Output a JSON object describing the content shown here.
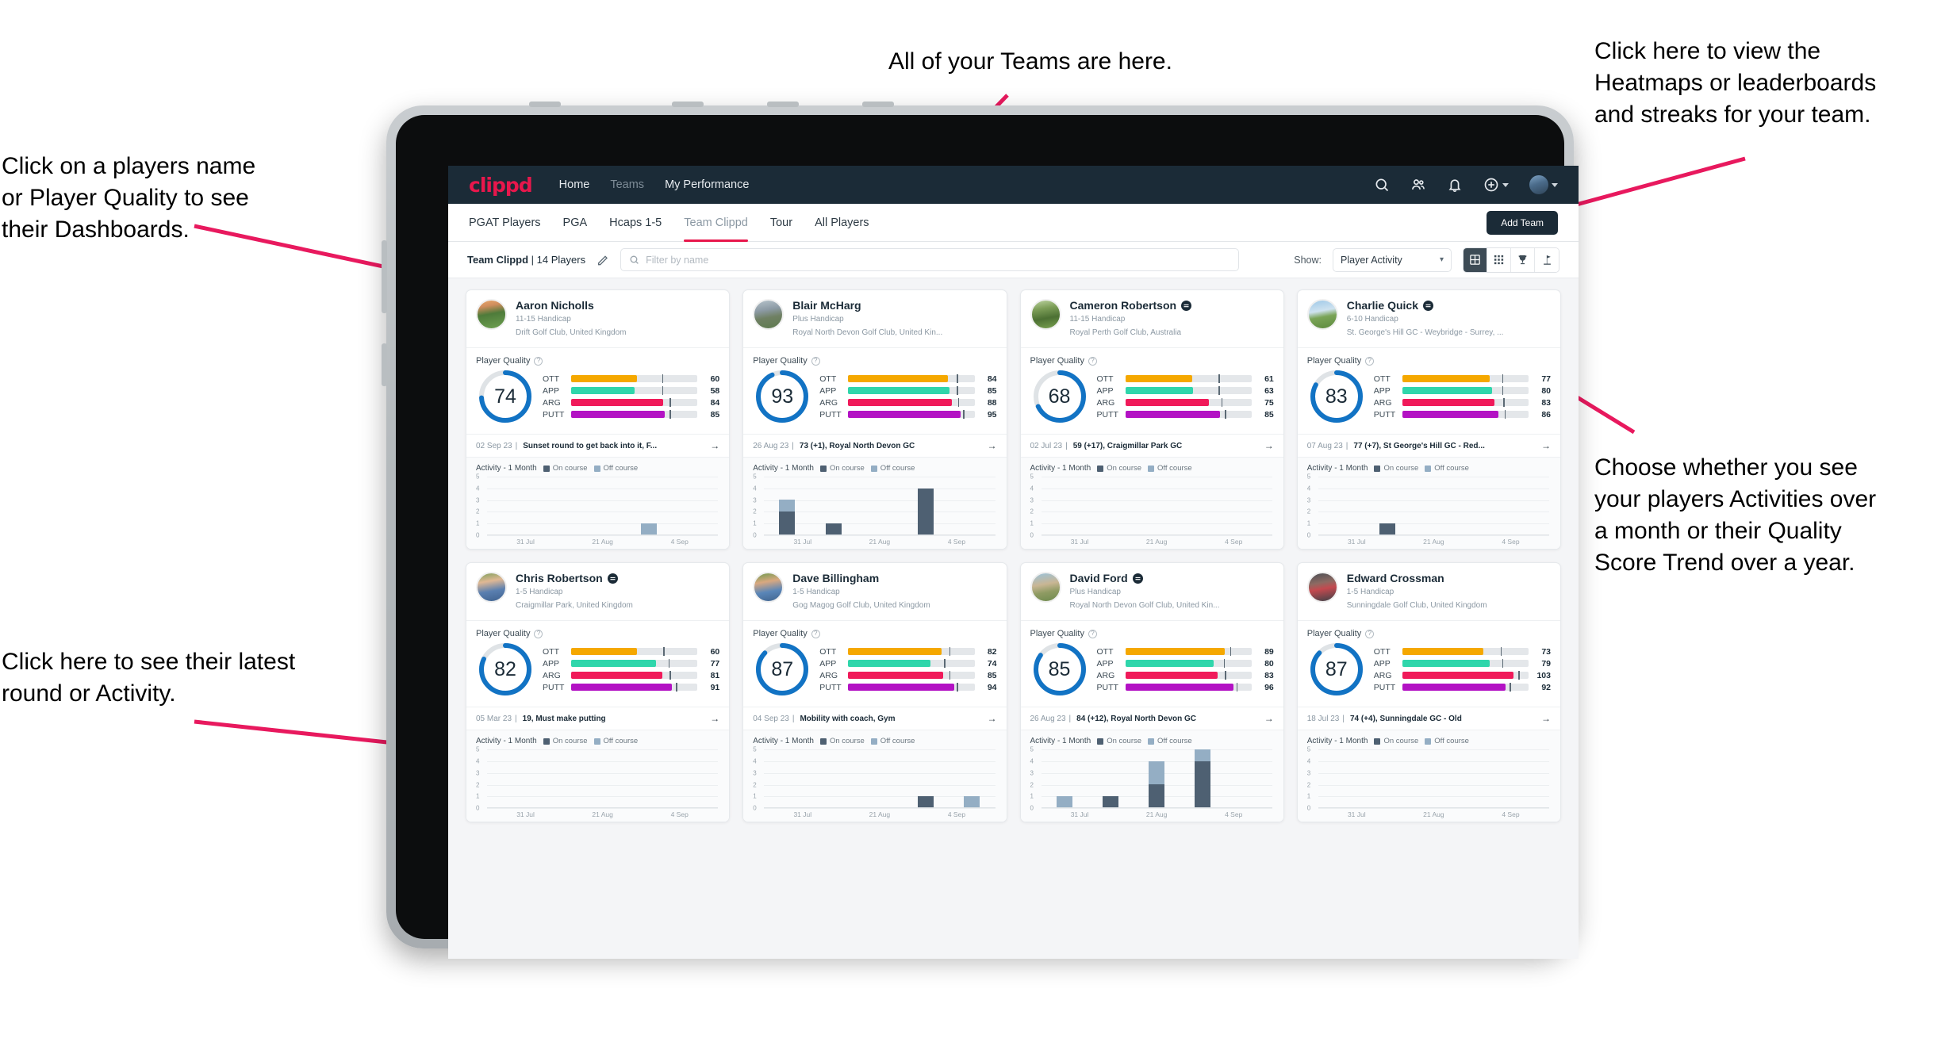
{
  "annotations": {
    "teams": "All of your Teams are here.",
    "heatmaps": "Click here to view the\nHeatmaps or leaderboards\nand streaks for your team.",
    "players": "Click on a players name\nor Player Quality to see\ntheir Dashboards.",
    "choose": "Choose whether you see\nyour players Activities over\na month or their Quality\nScore Trend over a year.",
    "round": "Click here to see their latest\nround or Activity."
  },
  "header": {
    "logo": "clippd",
    "nav": [
      {
        "label": "Home",
        "dim": false
      },
      {
        "label": "Teams",
        "dim": true
      },
      {
        "label": "My Performance",
        "dim": false
      }
    ],
    "icons": [
      "search-icon",
      "people-icon",
      "bell-icon",
      "plus-circle-icon",
      "avatar"
    ]
  },
  "tabs": [
    {
      "label": "PGAT Players",
      "active": false,
      "dim": false
    },
    {
      "label": "PGA",
      "active": false,
      "dim": false
    },
    {
      "label": "Hcaps 1-5",
      "active": false,
      "dim": false
    },
    {
      "label": "Team Clippd",
      "active": true,
      "dim": true
    },
    {
      "label": "Tour",
      "active": false,
      "dim": false
    },
    {
      "label": "All Players",
      "active": false,
      "dim": false
    }
  ],
  "add_team_label": "Add Team",
  "toolbar": {
    "team_name": "Team Clippd",
    "team_count": "14 Players",
    "search_placeholder": "Filter by name",
    "search_value": "",
    "show_label": "Show:",
    "show_value": "Player Activity",
    "views": [
      {
        "name": "grid-view",
        "active": true
      },
      {
        "name": "dense-grid-view",
        "active": false
      },
      {
        "name": "trophy-view",
        "active": false
      },
      {
        "name": "flag-view",
        "active": false
      }
    ]
  },
  "card_labels": {
    "quality": "Player Quality",
    "activity": "Activity - 1 Month",
    "on_course": "On course",
    "off_course": "Off course",
    "metric_labels": [
      "OTT",
      "APP",
      "ARG",
      "PUTT"
    ],
    "x_ticks": [
      "31 Jul",
      "21 Aug",
      "4 Sep"
    ],
    "y_ticks": [
      "5",
      "4",
      "3",
      "2",
      "1",
      "0"
    ]
  },
  "metric_colors": {
    "OTT": "#f5a800",
    "APP": "#2fd6ab",
    "ARG": "#f01a5a",
    "PUTT": "#b312c4",
    "ring": "#1273c4",
    "on_course": "#4e6072",
    "off_course": "#94aec4"
  },
  "chart_data": {
    "type": "bar",
    "title": "Activity - 1 Month",
    "ylabel": "",
    "xlabel": "",
    "ylim": [
      0,
      5
    ],
    "categories": [
      "31 Jul",
      "21 Aug",
      "4 Sep"
    ],
    "legend": [
      "On course",
      "Off course"
    ],
    "legend_position": "top-right",
    "grid": true,
    "panels": [
      {
        "player": "Aaron Nicholls",
        "bins": 5,
        "on_course": [
          0,
          0,
          0,
          0,
          0
        ],
        "off_course": [
          0,
          0,
          0,
          1,
          0
        ]
      },
      {
        "player": "Blair McHarg",
        "bins": 5,
        "on_course": [
          2,
          1,
          0,
          4,
          0
        ],
        "off_course": [
          1,
          0,
          0,
          0,
          0
        ]
      },
      {
        "player": "Cameron Robertson",
        "bins": 5,
        "on_course": [
          0,
          0,
          0,
          0,
          0
        ],
        "off_course": [
          0,
          0,
          0,
          0,
          0
        ]
      },
      {
        "player": "Charlie Quick",
        "bins": 5,
        "on_course": [
          0,
          1,
          0,
          0,
          0
        ],
        "off_course": [
          0,
          0,
          0,
          0,
          0
        ]
      },
      {
        "player": "Chris Robertson",
        "bins": 5,
        "on_course": [
          0,
          0,
          0,
          0,
          0
        ],
        "off_course": [
          0,
          0,
          0,
          0,
          0
        ]
      },
      {
        "player": "Dave Billingham",
        "bins": 5,
        "on_course": [
          0,
          0,
          0,
          1,
          0
        ],
        "off_course": [
          0,
          0,
          0,
          0,
          1
        ]
      },
      {
        "player": "David Ford",
        "bins": 5,
        "on_course": [
          0,
          1,
          2,
          4,
          0
        ],
        "off_course": [
          1,
          0,
          2,
          1,
          0
        ]
      },
      {
        "player": "Edward Crossman",
        "bins": 5,
        "on_course": [
          0,
          0,
          0,
          0,
          0
        ],
        "off_course": [
          0,
          0,
          0,
          0,
          0
        ]
      }
    ]
  },
  "players": [
    {
      "name": "Aaron Nicholls",
      "verified": false,
      "handicap": "11-15 Handicap",
      "club": "Drift Golf Club, United Kingdom",
      "quality": 74,
      "metrics": [
        {
          "label": "OTT",
          "value": 60,
          "fill": 52,
          "tick": 72
        },
        {
          "label": "APP",
          "value": 58,
          "fill": 50,
          "tick": 72
        },
        {
          "label": "ARG",
          "value": 84,
          "fill": 73,
          "tick": 78
        },
        {
          "label": "PUTT",
          "value": 85,
          "fill": 74,
          "tick": 78
        }
      ],
      "round_date": "02 Sep 23",
      "round_text": "Sunset round to get back into it, F...",
      "avatar_css": "linear-gradient(170deg,#e9a86c 0%,#cf8d5d 22%,#4e7b3a 48%,#6da050 100%)"
    },
    {
      "name": "Blair McHarg",
      "verified": false,
      "handicap": "Plus Handicap",
      "club": "Royal North Devon Golf Club, United Kin...",
      "quality": 93,
      "metrics": [
        {
          "label": "OTT",
          "value": 84,
          "fill": 79,
          "tick": 86
        },
        {
          "label": "APP",
          "value": 85,
          "fill": 80,
          "tick": 86
        },
        {
          "label": "ARG",
          "value": 88,
          "fill": 82,
          "tick": 87
        },
        {
          "label": "PUTT",
          "value": 95,
          "fill": 89,
          "tick": 91
        }
      ],
      "round_date": "26 Aug 23",
      "round_text": "73 (+1), Royal North Devon GC",
      "avatar_css": "linear-gradient(170deg,#b7c4cc 0%,#8c9aa4 35%,#6f8063 60%,#5d7a4e 100%)"
    },
    {
      "name": "Cameron Robertson",
      "verified": true,
      "handicap": "11-15 Handicap",
      "club": "Royal Perth Golf Club, Australia",
      "quality": 68,
      "metrics": [
        {
          "label": "OTT",
          "value": 61,
          "fill": 53,
          "tick": 74
        },
        {
          "label": "APP",
          "value": 63,
          "fill": 54,
          "tick": 74
        },
        {
          "label": "ARG",
          "value": 75,
          "fill": 66,
          "tick": 76
        },
        {
          "label": "PUTT",
          "value": 85,
          "fill": 75,
          "tick": 79
        }
      ],
      "round_date": "02 Jul 23",
      "round_text": "59 (+17), Craigmillar Park GC",
      "avatar_css": "linear-gradient(170deg,#bcd3a0 0%,#7d9e58 30%,#4c7033 62%,#7aa24f 100%)"
    },
    {
      "name": "Charlie Quick",
      "verified": true,
      "handicap": "6-10 Handicap",
      "club": "St. George's Hill GC - Weybridge - Surrey, ...",
      "quality": 83,
      "metrics": [
        {
          "label": "OTT",
          "value": 77,
          "fill": 69,
          "tick": 79
        },
        {
          "label": "APP",
          "value": 80,
          "fill": 71,
          "tick": 79
        },
        {
          "label": "ARG",
          "value": 83,
          "fill": 73,
          "tick": 80
        },
        {
          "label": "PUTT",
          "value": 86,
          "fill": 76,
          "tick": 81
        }
      ],
      "round_date": "07 Aug 23",
      "round_text": "77 (+7), St George's Hill GC - Red...",
      "avatar_css": "linear-gradient(170deg,#9fc9e8 0%,#cfe2ef 38%,#7aa457 58%,#5d8a3e 100%)"
    },
    {
      "name": "Chris Robertson",
      "verified": true,
      "handicap": "1-5 Handicap",
      "club": "Craigmillar Park, United Kingdom",
      "quality": 82,
      "metrics": [
        {
          "label": "OTT",
          "value": 60,
          "fill": 52,
          "tick": 73
        },
        {
          "label": "APP",
          "value": 77,
          "fill": 67,
          "tick": 77
        },
        {
          "label": "ARG",
          "value": 81,
          "fill": 72,
          "tick": 78
        },
        {
          "label": "PUTT",
          "value": 91,
          "fill": 80,
          "tick": 83
        }
      ],
      "round_date": "05 Mar 23",
      "round_text": "19, Must make putting",
      "avatar_css": "linear-gradient(170deg,#7fa05c 0%,#e0b894 30%,#5a7fb0 62%,#3f628f 100%)"
    },
    {
      "name": "Dave Billingham",
      "verified": false,
      "handicap": "1-5 Handicap",
      "club": "Gog Magog Golf Club, United Kingdom",
      "quality": 87,
      "metrics": [
        {
          "label": "OTT",
          "value": 82,
          "fill": 74,
          "tick": 80
        },
        {
          "label": "APP",
          "value": 74,
          "fill": 65,
          "tick": 76
        },
        {
          "label": "ARG",
          "value": 85,
          "fill": 75,
          "tick": 80
        },
        {
          "label": "PUTT",
          "value": 94,
          "fill": 84,
          "tick": 86
        }
      ],
      "round_date": "04 Sep 23",
      "round_text": "Mobility with coach, Gym",
      "avatar_css": "linear-gradient(170deg,#6f9a4e 0%,#d9a880 32%,#5a86b8 64%,#41648e 100%)"
    },
    {
      "name": "David Ford",
      "verified": true,
      "handicap": "Plus Handicap",
      "club": "Royal North Devon Golf Club, United Kin...",
      "quality": 85,
      "metrics": [
        {
          "label": "OTT",
          "value": 89,
          "fill": 79,
          "tick": 83
        },
        {
          "label": "APP",
          "value": 80,
          "fill": 70,
          "tick": 78
        },
        {
          "label": "ARG",
          "value": 83,
          "fill": 73,
          "tick": 79
        },
        {
          "label": "PUTT",
          "value": 96,
          "fill": 86,
          "tick": 88
        }
      ],
      "round_date": "26 Aug 23",
      "round_text": "84 (+12), Royal North Devon GC",
      "avatar_css": "linear-gradient(170deg,#9bc3dc 0%,#c9b694 40%,#8f9b63 66%,#6e8a4e 100%)"
    },
    {
      "name": "Edward Crossman",
      "verified": false,
      "handicap": "1-5 Handicap",
      "club": "Sunningdale Golf Club, United Kingdom",
      "quality": 87,
      "metrics": [
        {
          "label": "OTT",
          "value": 73,
          "fill": 64,
          "tick": 78
        },
        {
          "label": "APP",
          "value": 79,
          "fill": 69,
          "tick": 79
        },
        {
          "label": "ARG",
          "value": 103,
          "fill": 88,
          "tick": 92
        },
        {
          "label": "PUTT",
          "value": 92,
          "fill": 82,
          "tick": 85
        }
      ],
      "round_date": "18 Jul 23",
      "round_text": "74 (+4), Sunningdale GC - Old",
      "avatar_css": "linear-gradient(170deg,#4a4f55 0%,#8d6a62 35%,#c4494f 55%,#3d4248 100%)"
    }
  ]
}
